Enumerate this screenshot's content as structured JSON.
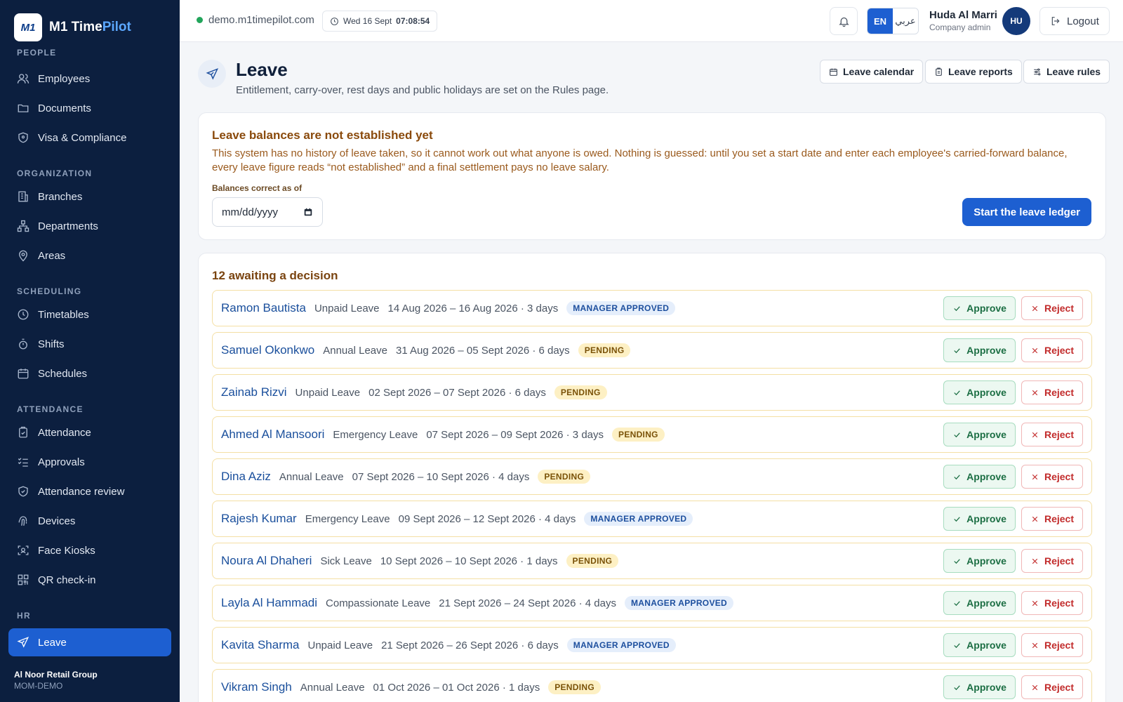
{
  "brand": {
    "logo_text": "M1",
    "name_main": "M1 Time",
    "name_accent": "Pilot"
  },
  "sidebar": {
    "sections": [
      {
        "label": "PEOPLE",
        "items": [
          "Employees",
          "Documents",
          "Visa & Compliance"
        ]
      },
      {
        "label": "ORGANIZATION",
        "items": [
          "Branches",
          "Departments",
          "Areas"
        ]
      },
      {
        "label": "SCHEDULING",
        "items": [
          "Timetables",
          "Shifts",
          "Schedules"
        ]
      },
      {
        "label": "ATTENDANCE",
        "items": [
          "Attendance",
          "Approvals",
          "Attendance review",
          "Devices",
          "Face Kiosks",
          "QR check-in"
        ]
      },
      {
        "label": "HR",
        "items": [
          "Leave"
        ]
      }
    ],
    "active_item": "Leave",
    "org_name": "Al Noor Retail Group",
    "org_code": "MOM-DEMO"
  },
  "topbar": {
    "domain": "demo.m1timepilot.com",
    "date": "Wed 16 Sept",
    "time": "07:08:54",
    "lang_en": "EN",
    "lang_ar": "عربي",
    "user_name": "Huda Al Marri",
    "user_role": "Company admin",
    "avatar_initials": "HU",
    "logout_label": "Logout"
  },
  "page": {
    "title": "Leave",
    "subtitle": "Entitlement, carry-over, rest days and public holidays are set on the Rules page.",
    "buttons": {
      "calendar": "Leave calendar",
      "reports": "Leave reports",
      "rules": "Leave rules"
    }
  },
  "notice": {
    "title": "Leave balances are not established yet",
    "body": "This system has no history of leave taken, so it cannot work out what anyone is owed. Nothing is guessed: until you set a start date and enter each employee's carried-forward balance, every leave figure reads “not established” and a final settlement pays no leave salary.",
    "date_label": "Balances correct as of",
    "date_placeholder": "mm/dd/yyyy",
    "button": "Start the leave ledger"
  },
  "requests": {
    "title": "12 awaiting a decision",
    "approve_label": "Approve",
    "reject_label": "Reject",
    "rows": [
      {
        "name": "Ramon Bautista",
        "type": "Unpaid Leave",
        "dates": "14 Aug 2026 – 16 Aug 2026 · 3 days",
        "status": "MANAGER APPROVED",
        "kind": "manager"
      },
      {
        "name": "Samuel Okonkwo",
        "type": "Annual Leave",
        "dates": "31 Aug 2026 – 05 Sept 2026 · 6 days",
        "status": "PENDING",
        "kind": "pending"
      },
      {
        "name": "Zainab Rizvi",
        "type": "Unpaid Leave",
        "dates": "02 Sept 2026 – 07 Sept 2026 · 6 days",
        "status": "PENDING",
        "kind": "pending"
      },
      {
        "name": "Ahmed Al Mansoori",
        "type": "Emergency Leave",
        "dates": "07 Sept 2026 – 09 Sept 2026 · 3 days",
        "status": "PENDING",
        "kind": "pending"
      },
      {
        "name": "Dina Aziz",
        "type": "Annual Leave",
        "dates": "07 Sept 2026 – 10 Sept 2026 · 4 days",
        "status": "PENDING",
        "kind": "pending"
      },
      {
        "name": "Rajesh Kumar",
        "type": "Emergency Leave",
        "dates": "09 Sept 2026 – 12 Sept 2026 · 4 days",
        "status": "MANAGER APPROVED",
        "kind": "manager"
      },
      {
        "name": "Noura Al Dhaheri",
        "type": "Sick Leave",
        "dates": "10 Sept 2026 – 10 Sept 2026 · 1 days",
        "status": "PENDING",
        "kind": "pending"
      },
      {
        "name": "Layla Al Hammadi",
        "type": "Compassionate Leave",
        "dates": "21 Sept 2026 – 24 Sept 2026 · 4 days",
        "status": "MANAGER APPROVED",
        "kind": "manager"
      },
      {
        "name": "Kavita Sharma",
        "type": "Unpaid Leave",
        "dates": "21 Sept 2026 – 26 Sept 2026 · 6 days",
        "status": "MANAGER APPROVED",
        "kind": "manager"
      },
      {
        "name": "Vikram Singh",
        "type": "Annual Leave",
        "dates": "01 Oct 2026 – 01 Oct 2026 · 1 days",
        "status": "PENDING",
        "kind": "pending"
      }
    ]
  }
}
